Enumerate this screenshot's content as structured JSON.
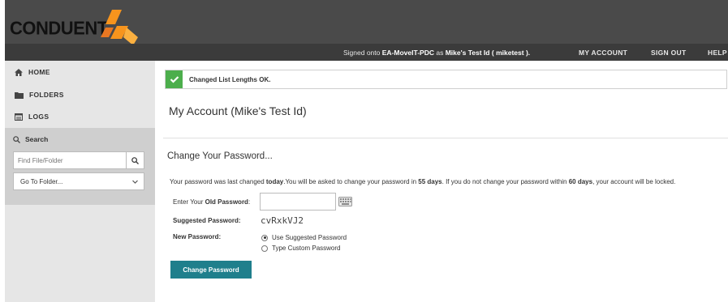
{
  "header": {
    "logo_text": "CONDUENT",
    "signed_on": {
      "prefix": "Signed onto",
      "server": "EA-MoveIT-PDC",
      "as": "as",
      "user": "Mike's Test Id",
      "userid_open": "(",
      "userid": "miketest",
      "userid_close": ")."
    },
    "links": {
      "my_account": "MY ACCOUNT",
      "sign_out": "SIGN OUT",
      "help": "HELP"
    }
  },
  "sidebar": {
    "items": [
      {
        "label": "HOME",
        "icon": "home-icon"
      },
      {
        "label": "FOLDERS",
        "icon": "folder-icon"
      },
      {
        "label": "LOGS",
        "icon": "logs-icon"
      }
    ],
    "search": {
      "label": "Search",
      "placeholder": "Find File/Folder",
      "goto_label": "Go To Folder..."
    }
  },
  "alert": {
    "text": "Changed List Lengths OK."
  },
  "main": {
    "title": "My Account (Mike's Test Id)",
    "section_title": "Change Your Password...",
    "info": {
      "p1": "Your password was last changed ",
      "when": "today",
      "p2": ".You will be asked to change your password in ",
      "days1": "55 days",
      "p3": ". If you do not change your password within ",
      "days2": "60 days",
      "p4": ", your account will be locked."
    },
    "form": {
      "old_label_prefix": "Enter Your ",
      "old_label_bold": "Old Password",
      "old_label_suffix": ":",
      "suggested_label": "Suggested Password:",
      "suggested_value": "cvRxkVJ2",
      "new_label": "New Password:",
      "options": [
        "Use Suggested Password",
        "Type Custom Password"
      ],
      "selected_option": 0,
      "submit_label": "Change Password"
    }
  },
  "colors": {
    "header_bg": "#4a4a4a",
    "logo_orange": "#f7941d",
    "success_green": "#4cae4c",
    "button_teal": "#1f7f8c"
  }
}
